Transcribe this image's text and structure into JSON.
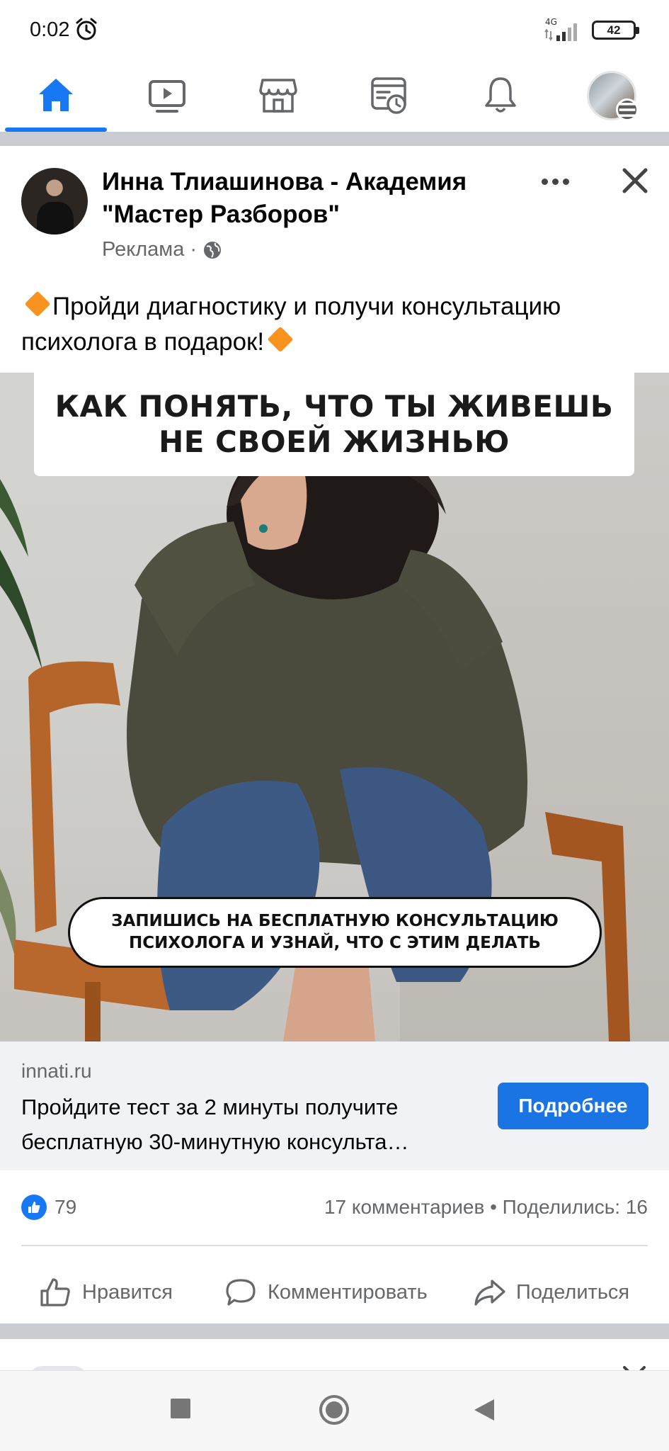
{
  "status_bar": {
    "time": "0:02",
    "network": "4G",
    "battery": "42"
  },
  "nav": {
    "tabs": [
      "home-icon",
      "video-icon",
      "marketplace-icon",
      "news-icon",
      "bell-icon",
      "profile-menu"
    ]
  },
  "post": {
    "page_name": "Инна Тлиашинова - Академия \"Мастер Разборов\"",
    "sponsored_label": "Реклама",
    "separator": "·",
    "text_main": "Пройди диагностику и получи консультацию психолога в подарок!",
    "image": {
      "headline": "КАК ПОНЯТЬ, ЧТО ТЫ ЖИВЕШЬ НЕ СВОЕЙ ЖИЗНЬЮ",
      "cta_banner": "ЗАПИШИСЬ НА БЕСПЛАТНУЮ КОНСУЛЬТАЦИЮ ПСИХОЛОГА И УЗНАЙ, ЧТО С ЭТИМ ДЕЛАТЬ"
    },
    "link": {
      "domain": "innati.ru",
      "title": "Пройдите тест за 2 минуты получите бесплатную 30-минутную консульта…",
      "button_label": "Подробнее"
    },
    "reactions": {
      "like_count": "79",
      "stats": "17 комментариев • Поделились: 16"
    },
    "actions": {
      "like": "Нравится",
      "comment": "Комментировать",
      "share": "Поделиться"
    }
  },
  "colors": {
    "accent": "#1877f2",
    "cta": "#1b74e4",
    "secondary_text": "#65676b",
    "separator": "#c9ccd1"
  }
}
